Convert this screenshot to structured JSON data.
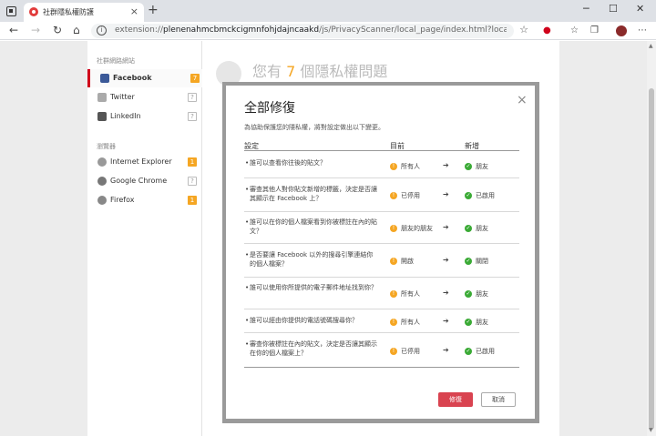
{
  "browser": {
    "tab_title": "社群隱私權防護",
    "tab_close": "×",
    "new_tab": "+",
    "minimize": "─",
    "maximize": "☐",
    "close": "✕",
    "url_prefix": "extension://",
    "url_main": "plenenahmcbmckcigmnfohjdajncaakd",
    "url_rest": "/js/PrivacyScanner/local_page/index.html?locale=zh_TW&br..."
  },
  "sidebar": {
    "social_title": "社群網路網站",
    "social_items": [
      {
        "label": "Facebook",
        "badge": "7",
        "color": "#3b5998"
      },
      {
        "label": "Twitter",
        "badge": "?",
        "color": "#1da1f2"
      },
      {
        "label": "LinkedIn",
        "badge": "?",
        "color": "#0077b5"
      }
    ],
    "browser_title": "瀏覽器",
    "browser_items": [
      {
        "label": "Internet Explorer",
        "badge": "1",
        "color": "#1ebbee"
      },
      {
        "label": "Google Chrome",
        "badge": "?",
        "color": "#4caf50"
      },
      {
        "label": "Firefox",
        "badge": "1",
        "color": "#ff7139"
      }
    ]
  },
  "main": {
    "head_prefix": "您有 ",
    "head_count": "7",
    "head_suffix": " 個隱私權問題"
  },
  "dialog": {
    "title": "全部修復",
    "close": "×",
    "description": "為協助保護您的隱私權，將對設定做出以下變更。",
    "col_setting": "設定",
    "col_current": "目前",
    "col_new": "新增",
    "rows": [
      {
        "setting": "誰可以查看你往後的貼文？",
        "current": "所有人",
        "new": "朋友"
      },
      {
        "setting": "審查其他人對你貼文新增的標籤，決定是否讓其顯示在 Facebook 上？",
        "current": "已停用",
        "new": "已啟用"
      },
      {
        "setting": "誰可以在你的個人檔案看到你被標註在內的貼文？",
        "current": "朋友的朋友",
        "new": "朋友"
      },
      {
        "setting": "是否要讓 Facebook 以外的搜尋引擎連結你的個人檔案？",
        "current": "開啟",
        "new": "關閉"
      },
      {
        "setting": "誰可以使用你所提供的電子郵件地址找到你？",
        "current": "所有人",
        "new": "朋友"
      },
      {
        "setting": "誰可以經由你提供的電話號碼搜尋你？",
        "current": "所有人",
        "new": "朋友"
      },
      {
        "setting": "審查你被標註在內的貼文，決定是否讓其顯示在你的個人檔案上？",
        "current": "已停用",
        "new": "已啟用"
      }
    ],
    "fix_button": "修復",
    "cancel_button": "取消"
  }
}
